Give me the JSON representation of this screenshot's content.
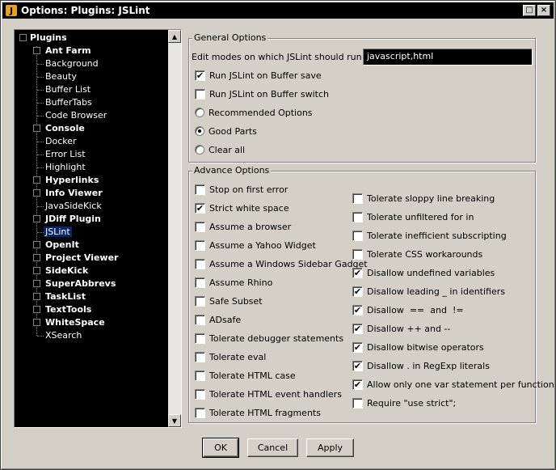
{
  "window": {
    "title": "Options: Plugins: JSLint",
    "icon_glyph": "J",
    "restore_glyph": "□",
    "close_glyph": "×"
  },
  "tree": {
    "items": [
      {
        "label": "Plugins",
        "bold": true,
        "level": 0
      },
      {
        "label": "Ant Farm",
        "bold": true,
        "level": 1
      },
      {
        "label": "Background",
        "bold": false,
        "level": 1
      },
      {
        "label": "Beauty",
        "bold": false,
        "level": 1
      },
      {
        "label": "Buffer List",
        "bold": false,
        "level": 1
      },
      {
        "label": "BufferTabs",
        "bold": false,
        "level": 1
      },
      {
        "label": "Code Browser",
        "bold": false,
        "level": 1
      },
      {
        "label": "Console",
        "bold": true,
        "level": 1
      },
      {
        "label": "Docker",
        "bold": false,
        "level": 1
      },
      {
        "label": "Error List",
        "bold": false,
        "level": 1
      },
      {
        "label": "Highlight",
        "bold": false,
        "level": 1
      },
      {
        "label": "Hyperlinks",
        "bold": true,
        "level": 1
      },
      {
        "label": "Info Viewer",
        "bold": true,
        "level": 1
      },
      {
        "label": "JavaSideKick",
        "bold": false,
        "level": 1
      },
      {
        "label": "JDiff Plugin",
        "bold": true,
        "level": 1
      },
      {
        "label": "JSLint",
        "bold": false,
        "level": 1,
        "selected": true
      },
      {
        "label": "OpenIt",
        "bold": true,
        "level": 1
      },
      {
        "label": "Project Viewer",
        "bold": true,
        "level": 1
      },
      {
        "label": "SideKick",
        "bold": true,
        "level": 1
      },
      {
        "label": "SuperAbbrevs",
        "bold": true,
        "level": 1
      },
      {
        "label": "TaskList",
        "bold": true,
        "level": 1
      },
      {
        "label": "TextTools",
        "bold": true,
        "level": 1
      },
      {
        "label": "WhiteSpace",
        "bold": true,
        "level": 1
      },
      {
        "label": "XSearch",
        "bold": false,
        "level": 1
      }
    ],
    "scroll_up": "▲",
    "scroll_down": "▼"
  },
  "general": {
    "title": "General Options",
    "edit_modes_label": "Edit modes on which JSLint should run",
    "edit_modes_value": "javascript,html",
    "checks": [
      {
        "label": "Run JSLint on Buffer save",
        "checked": true
      },
      {
        "label": "Run JSLint on Buffer switch",
        "checked": false
      }
    ],
    "radios": [
      {
        "label": "Recommended Options",
        "selected": false
      },
      {
        "label": "Good Parts",
        "selected": true
      },
      {
        "label": "Clear all",
        "selected": false
      }
    ]
  },
  "advance": {
    "title": "Advance Options",
    "left": [
      {
        "label": "Stop on first error",
        "checked": false
      },
      {
        "label": "Strict white space",
        "checked": true
      },
      {
        "label": "Assume a browser",
        "checked": false
      },
      {
        "label": "Assume a Yahoo Widget",
        "checked": false
      },
      {
        "label": "Assume a Windows Sidebar Gadget",
        "checked": false
      },
      {
        "label": "Assume Rhino",
        "checked": false
      },
      {
        "label": "Safe Subset",
        "checked": false
      },
      {
        "label": "ADsafe",
        "checked": false
      },
      {
        "label": "Tolerate debugger statements",
        "checked": false
      },
      {
        "label": "Tolerate eval",
        "checked": false
      },
      {
        "label": "Tolerate HTML case",
        "checked": false
      },
      {
        "label": "Tolerate HTML event handlers",
        "checked": false
      },
      {
        "label": "Tolerate HTML fragments",
        "checked": false
      }
    ],
    "right": [
      {
        "label": "Tolerate sloppy line breaking",
        "checked": false
      },
      {
        "label": "Tolerate unfiltered for in",
        "checked": false
      },
      {
        "label": "Tolerate inefficient subscripting",
        "checked": false
      },
      {
        "label": "Tolerate CSS workarounds",
        "checked": false
      },
      {
        "label": "Disallow undefined variables",
        "checked": true
      },
      {
        "label": "Disallow leading _ in identifiers",
        "checked": true
      },
      {
        "label": "Disallow  ==  and  !=",
        "checked": true
      },
      {
        "label": "Disallow ++ and --",
        "checked": true
      },
      {
        "label": "Disallow bitwise operators",
        "checked": true
      },
      {
        "label": "Disallow . in RegExp literals",
        "checked": true
      },
      {
        "label": "Allow only one var statement per function",
        "checked": true
      },
      {
        "label": "Require \"use strict\";",
        "checked": false
      }
    ]
  },
  "check_glyph": "✔",
  "buttons": {
    "ok": "OK",
    "cancel": "Cancel",
    "apply": "Apply"
  }
}
